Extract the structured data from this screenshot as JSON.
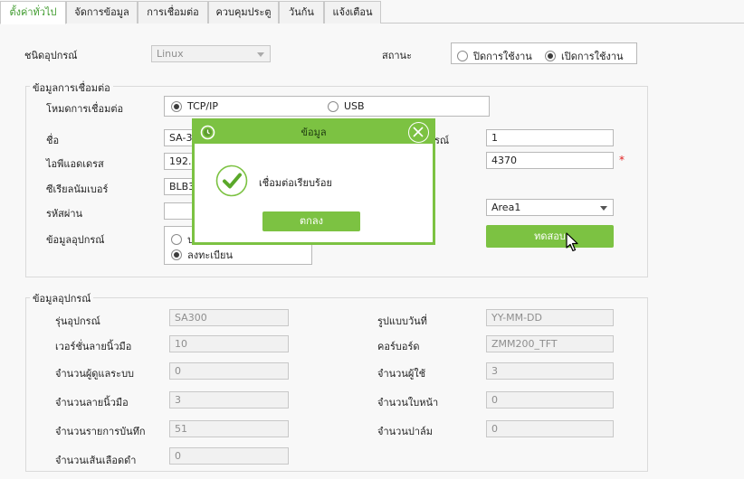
{
  "tabs": [
    {
      "label": "ตั้งค่าทั่วไป",
      "active": true
    },
    {
      "label": "จัดการข้อมูล",
      "active": false
    },
    {
      "label": "การเชื่อมต่อ",
      "active": false
    },
    {
      "label": "ควบคุมประตู",
      "active": false
    },
    {
      "label": "วันก้น",
      "active": false
    },
    {
      "label": "แจ้งเตือน",
      "active": false
    }
  ],
  "top": {
    "device_type_label": "ชนิดอุปกรณ์",
    "device_type_value": "Linux",
    "status_label": "สถานะ",
    "status_off": "ปิดการใช้งาน",
    "status_on": "เปิดการใช้งาน"
  },
  "connection": {
    "title": "ข้อมูลการเชื่อมต่อ",
    "mode_label": "โหมดการเชื่อมต่อ",
    "mode_tcp": "TCP/IP",
    "mode_usb": "USB",
    "name_label": "ชื่อ",
    "name_value": "SA-30",
    "ip_label": "ไอพีแอดเดรส",
    "ip_value": "192.1",
    "serial_label": "ซีเรียลนัมเบอร์",
    "serial_value": "BLB3",
    "password_label": "รหัสผ่าน",
    "password_value": "",
    "device_info_label": "ข้อมูลอุปกรณ์",
    "device_info_opt1": "ป",
    "device_info_opt2": "ลงทะเบียน",
    "right_label_partial": "รณ์",
    "machine_no_value": "1",
    "port_value": "4370",
    "required_mark": "*",
    "area_value": "Area1",
    "test_button": "ทดสอบ"
  },
  "device_info": {
    "title": "ข้อมูลอุปกรณ์",
    "left": [
      {
        "label": "รุ่นอุปกรณ์",
        "value": "SA300"
      },
      {
        "label": "เวอร์ชั่นลายนิ้วมือ",
        "value": "10"
      },
      {
        "label": "จำนวนผู้ดูแลระบบ",
        "value": "0"
      },
      {
        "label": "จำนวนลายนิ้วมือ",
        "value": "3"
      },
      {
        "label": "จำนวนรายการบันทึก",
        "value": "51"
      },
      {
        "label": "จำนวนเส้นเลือดดำ",
        "value": "0"
      }
    ],
    "right": [
      {
        "label": "รูปแบบวันที่",
        "value": "YY-MM-DD"
      },
      {
        "label": "คอร์บอร์ด",
        "value": "ZMM200_TFT"
      },
      {
        "label": "จำนวนผู้ใช้",
        "value": "3"
      },
      {
        "label": "จำนวนใบหน้า",
        "value": "0"
      },
      {
        "label": "จำนวนปาล์ม",
        "value": "0"
      }
    ]
  },
  "dialog": {
    "title": "ข้อมูล",
    "message": "เชื่อมต่อเรียบร้อย",
    "ok_button": "ตกลง"
  },
  "colors": {
    "accent": "#7cc242",
    "active_tab_text": "#3f9b2d",
    "required": "#e02020"
  },
  "icons": {
    "dialog_logo": "clock-logo-icon",
    "close": "close-icon",
    "success": "check-circle-icon",
    "pointer": "mouse-cursor-icon"
  }
}
